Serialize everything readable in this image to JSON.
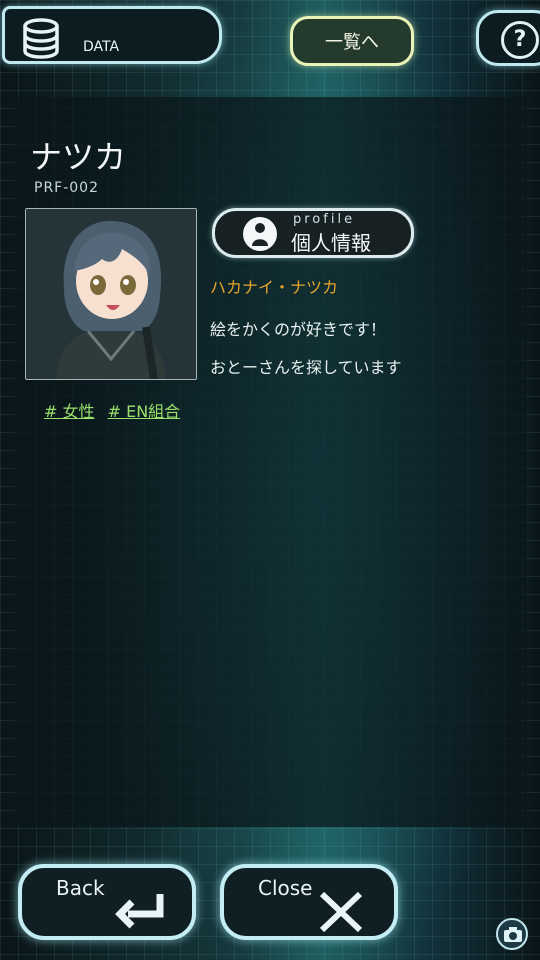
{
  "header": {
    "data_label": "DATA",
    "list_label": "一覧へ",
    "help_glyph": "?"
  },
  "profile": {
    "name": "ナツカ",
    "id": "PRF-002",
    "tags": [
      "# 女性",
      "# EN組合"
    ],
    "profile_button": {
      "small_label": "profile",
      "label": "個人情報"
    },
    "full_name": "ハカナイ・ナツカ",
    "lines": [
      "絵をかくのが好きです！",
      "おとーさんを探しています"
    ]
  },
  "footer": {
    "back_label": "Back",
    "close_label": "Close"
  },
  "icons": {
    "data": "database-icon",
    "help": "question-icon",
    "profile": "user-icon",
    "back": "return-arrow-icon",
    "close": "close-x-icon",
    "camera": "camera-icon"
  },
  "colors": {
    "accent_cyan": "#c3edf3",
    "list_button_border": "#e8f4b8",
    "full_name": "#e6a32c",
    "tag": "#9be06b"
  }
}
